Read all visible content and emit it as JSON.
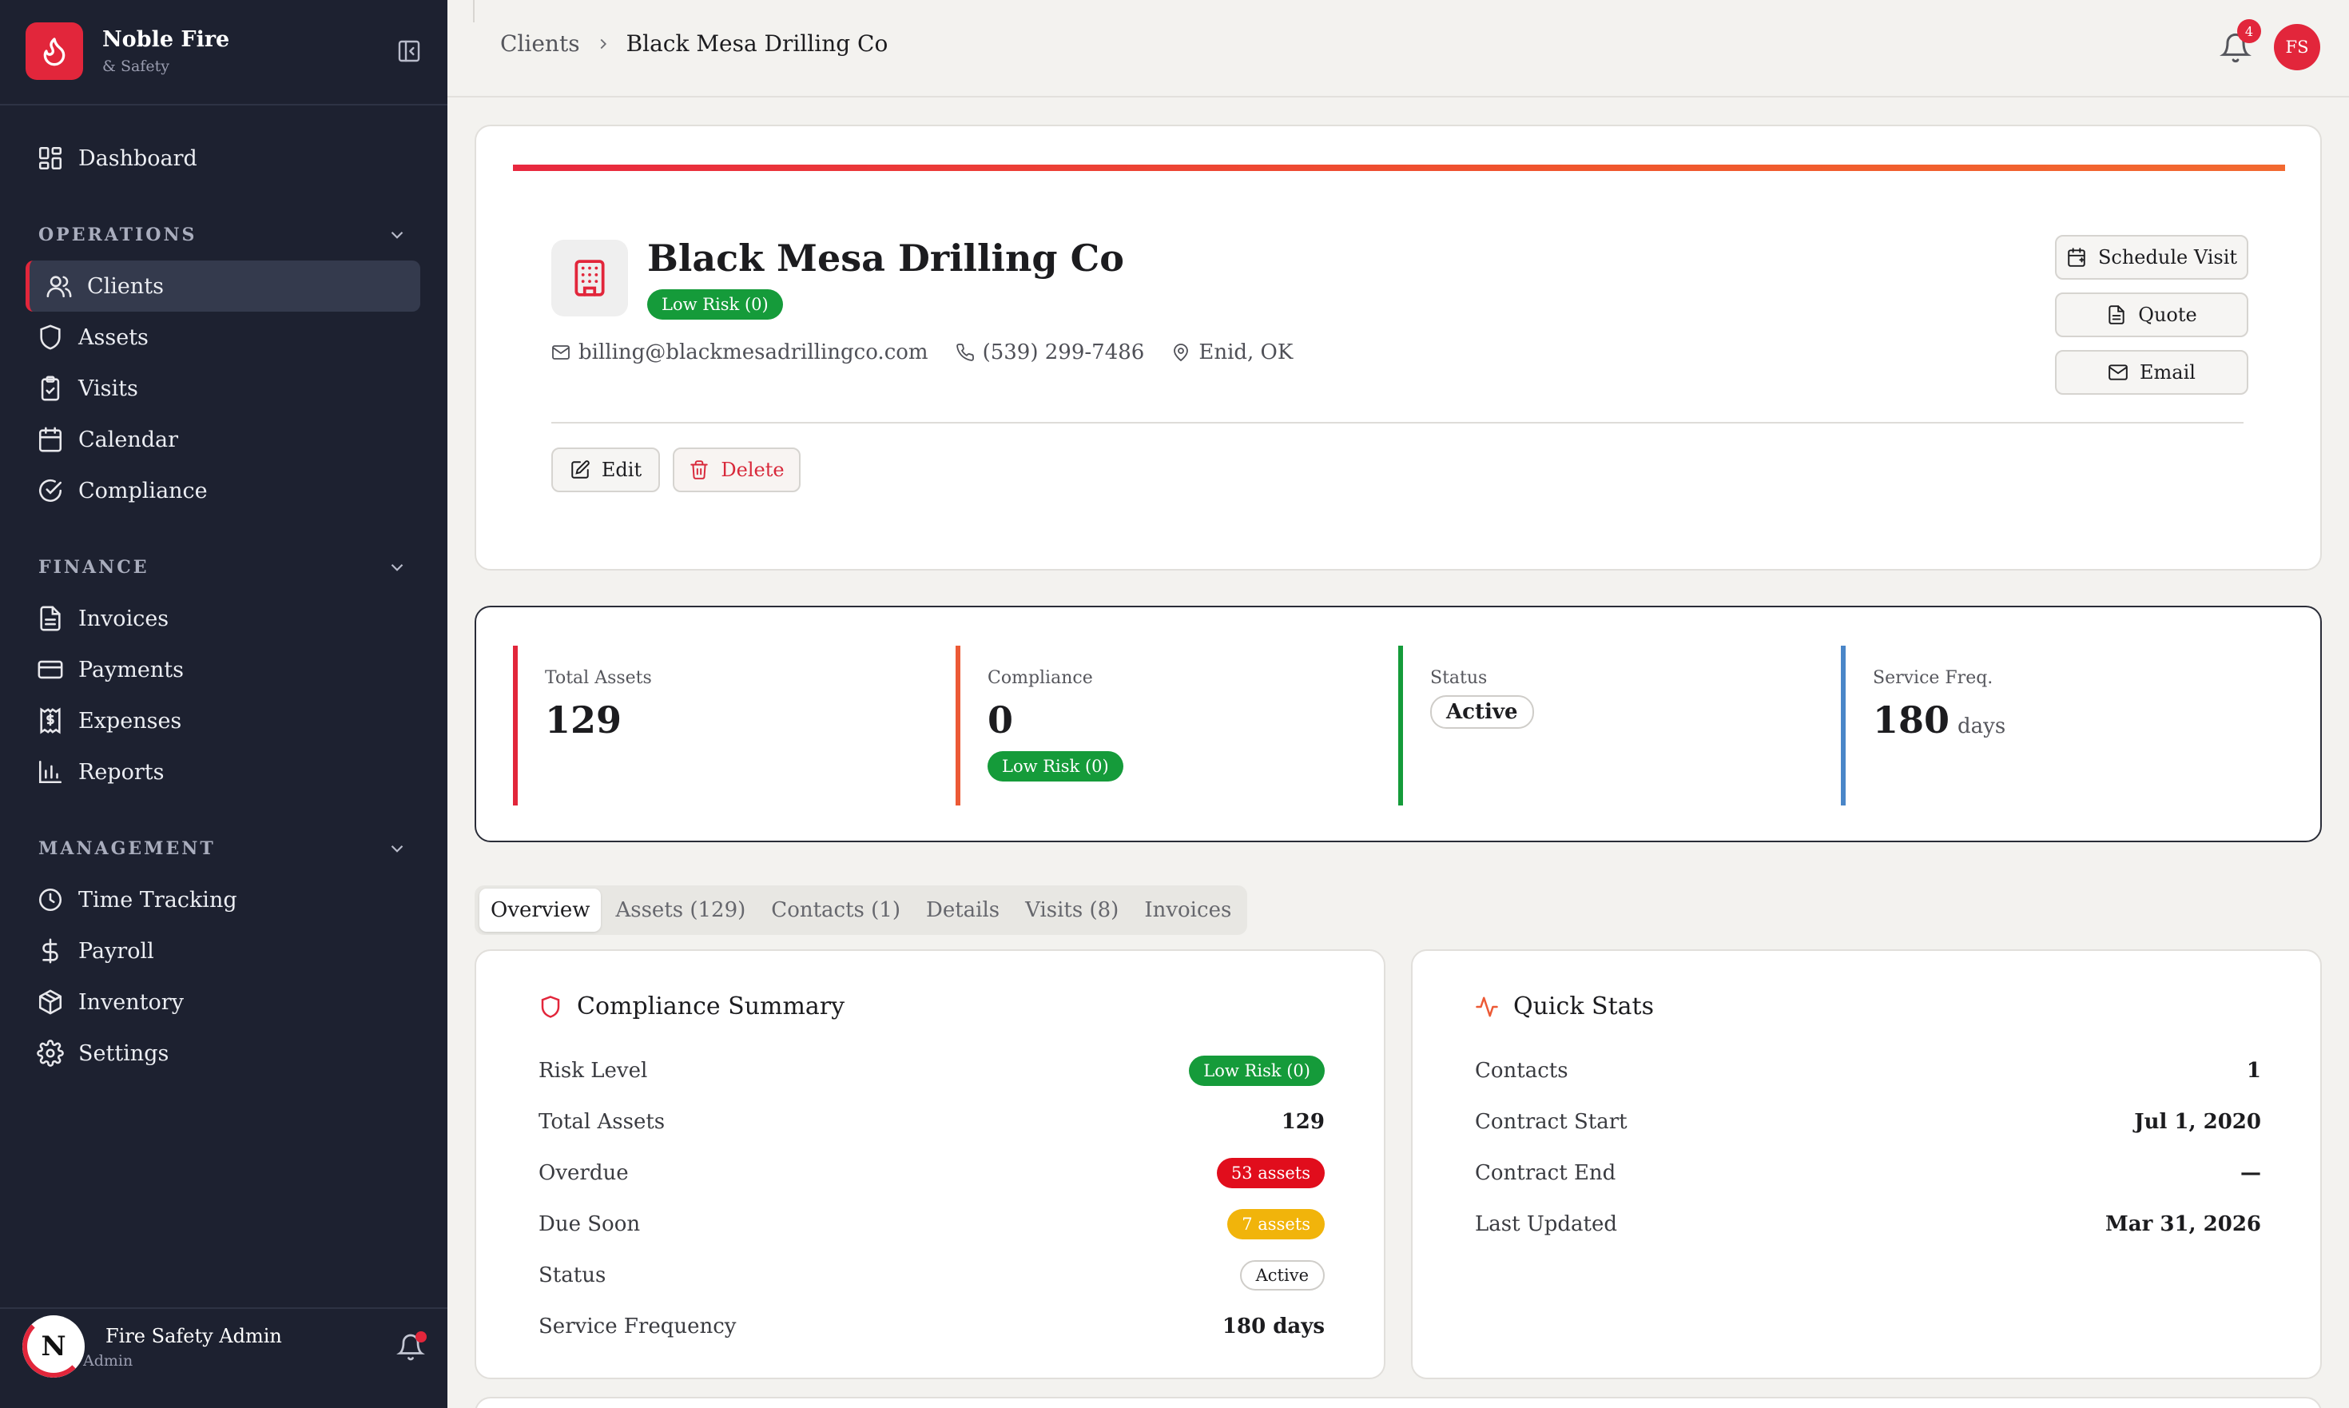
{
  "brand": {
    "name": "Noble Fire",
    "sub": "& Safety"
  },
  "nav": {
    "dashboard": "Dashboard",
    "operations": {
      "title": "OPERATIONS",
      "items": [
        "Clients",
        "Assets",
        "Visits",
        "Calendar",
        "Compliance"
      ]
    },
    "finance": {
      "title": "FINANCE",
      "items": [
        "Invoices",
        "Payments",
        "Expenses",
        "Reports"
      ]
    },
    "management": {
      "title": "MANAGEMENT",
      "items": [
        "Time Tracking",
        "Payroll",
        "Inventory",
        "Settings"
      ]
    }
  },
  "user": {
    "initial": "N",
    "name": "Fire Safety Admin",
    "role": "Admin"
  },
  "topbar": {
    "crumb_parent": "Clients",
    "crumb_current": "Black Mesa Drilling Co",
    "notif_count": "4",
    "avatar": "FS"
  },
  "client": {
    "name": "Black Mesa Drilling Co",
    "risk": "Low Risk (0)",
    "email": "billing@blackmesadrillingco.com",
    "phone": "(539) 299-7486",
    "location": "Enid, OK"
  },
  "actions": {
    "schedule": "Schedule Visit",
    "quote": "Quote",
    "email": "Email",
    "edit": "Edit",
    "delete": "Delete"
  },
  "stats": {
    "total_assets": {
      "label": "Total Assets",
      "value": "129"
    },
    "compliance": {
      "label": "Compliance",
      "value": "0",
      "badge": "Low Risk (0)"
    },
    "status": {
      "label": "Status",
      "value": "Active"
    },
    "service_freq": {
      "label": "Service Freq.",
      "value": "180",
      "unit": "days"
    }
  },
  "tabs": [
    "Overview",
    "Assets (129)",
    "Contacts (1)",
    "Details",
    "Visits (8)",
    "Invoices"
  ],
  "compliance_summary": {
    "title": "Compliance Summary",
    "rows": [
      {
        "label": "Risk Level",
        "value": "Low Risk (0)"
      },
      {
        "label": "Total Assets",
        "value": "129"
      },
      {
        "label": "Overdue",
        "value": "53 assets"
      },
      {
        "label": "Due Soon",
        "value": "7 assets"
      },
      {
        "label": "Status",
        "value": "Active"
      },
      {
        "label": "Service Frequency",
        "value": "180 days"
      }
    ]
  },
  "quick_stats": {
    "title": "Quick Stats",
    "rows": [
      {
        "label": "Contacts",
        "value": "1"
      },
      {
        "label": "Contract Start",
        "value": "Jul 1, 2020"
      },
      {
        "label": "Contract End",
        "value": "—"
      },
      {
        "label": "Last Updated",
        "value": "Mar 31, 2026"
      }
    ]
  },
  "colors": {
    "brand": "#e2263b",
    "sidebar": "#1d2130",
    "green": "#159b3a",
    "red": "#e10d1c",
    "amber": "#f1b40b",
    "blue": "#4a86c8",
    "orange": "#ec5a36"
  }
}
